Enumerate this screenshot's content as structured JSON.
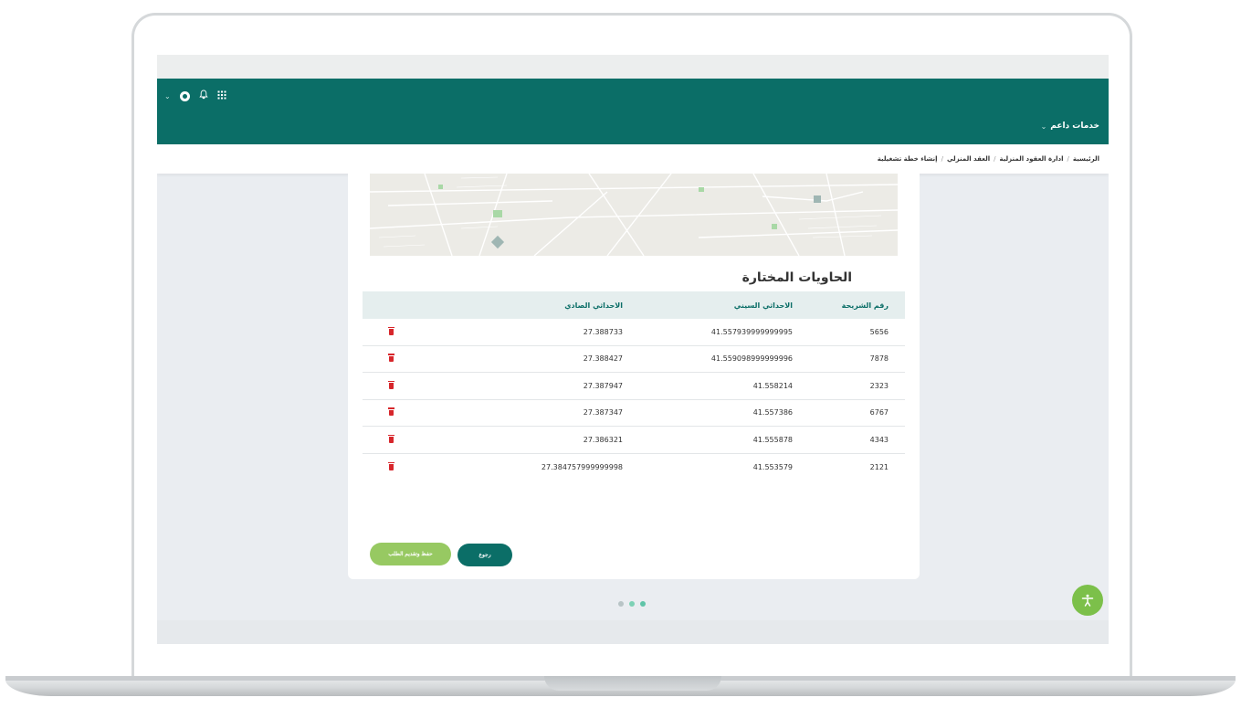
{
  "header": {
    "services_label": "خدمات داعم",
    "icons": [
      "apps-grid-icon",
      "bell-icon",
      "user-avatar-icon",
      "chevron-down-icon"
    ]
  },
  "breadcrumb": {
    "items": [
      "الرئيسية",
      "ادارة العقود المنزلية",
      "العقد المنزلي",
      "إنشاء خطة تشغيلية"
    ],
    "separator": "/"
  },
  "section": {
    "title": "الحاويات المختارة"
  },
  "table": {
    "headers": {
      "slice_number": "رقم الشريحة",
      "x_coord": "الاحداثي السيني",
      "y_coord": "الاحداثي الصادي"
    },
    "rows": [
      {
        "slice_number": "5656",
        "x_coord": "41.557939999999995",
        "y_coord": "27.388733"
      },
      {
        "slice_number": "7878",
        "x_coord": "41.559098999999996",
        "y_coord": "27.388427"
      },
      {
        "slice_number": "2323",
        "x_coord": "41.558214",
        "y_coord": "27.387947"
      },
      {
        "slice_number": "6767",
        "x_coord": "41.557386",
        "y_coord": "27.387347"
      },
      {
        "slice_number": "4343",
        "x_coord": "41.555878",
        "y_coord": "27.386321"
      },
      {
        "slice_number": "2121",
        "x_coord": "41.553579",
        "y_coord": "27.384757999999998"
      }
    ]
  },
  "buttons": {
    "back_label": "رجوع",
    "submit_label": "حفظ وتقديم الطلب"
  },
  "colors": {
    "primary": "#0b6e67",
    "accent_green": "#97c962",
    "delete_red": "#d7262b",
    "accessibility": "#7cc04a"
  }
}
